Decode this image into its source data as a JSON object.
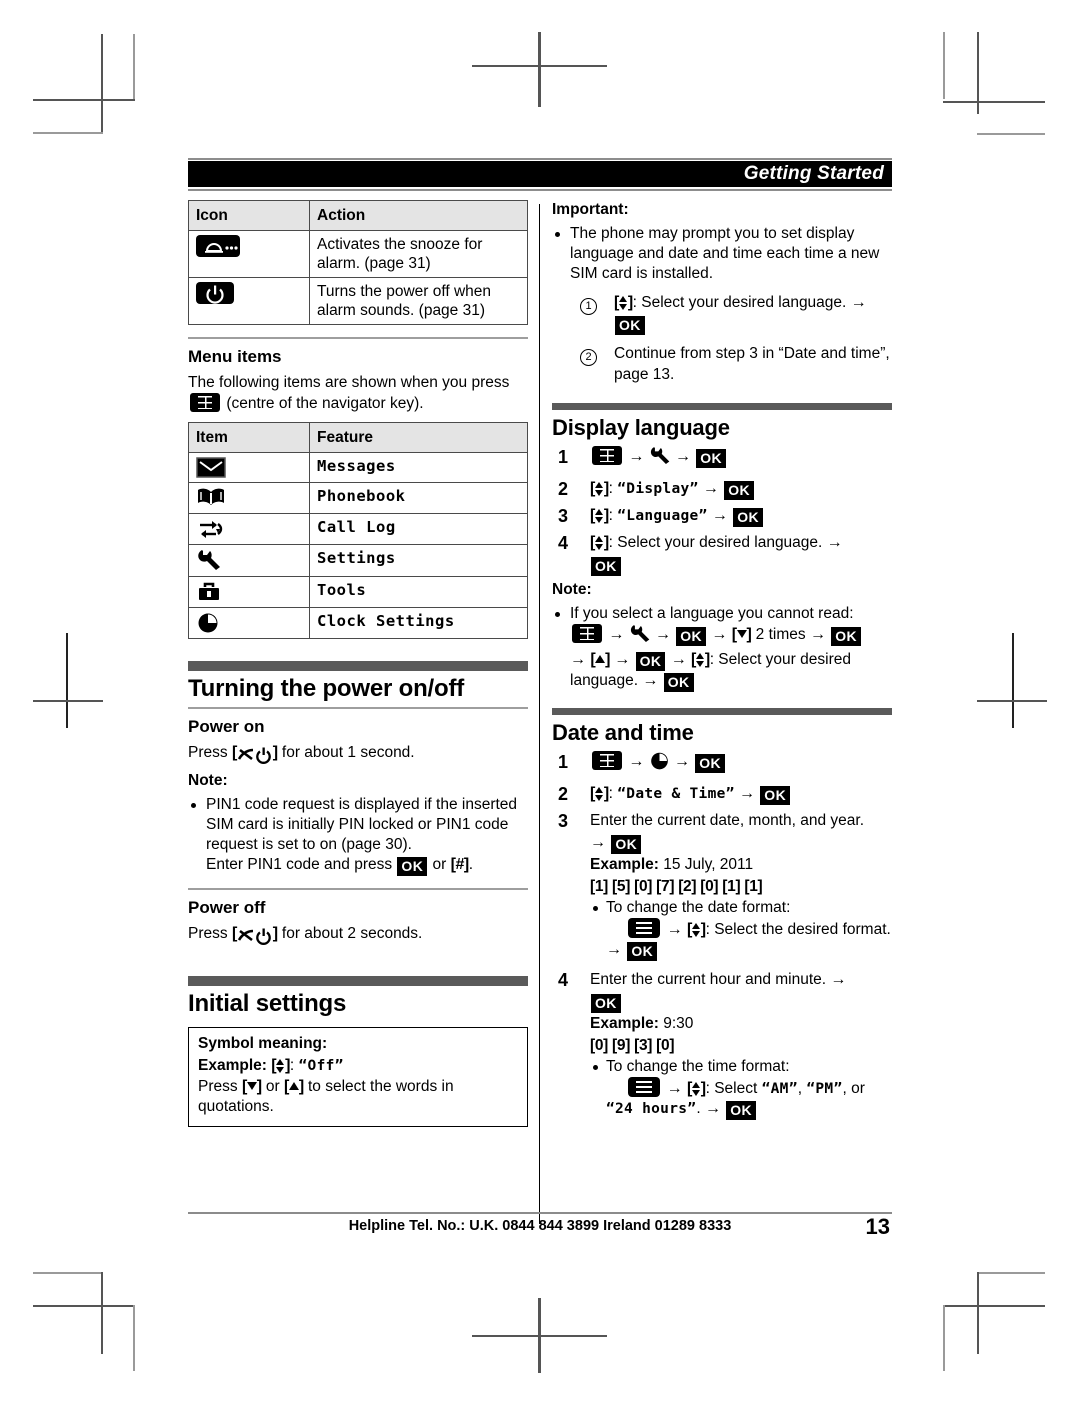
{
  "header": {
    "title": "Getting Started"
  },
  "icon_table": {
    "columns": [
      "Icon",
      "Action"
    ],
    "rows": [
      {
        "icon": "alarm-snooze-icon",
        "action": "Activates the snooze for alarm. (page 31)"
      },
      {
        "icon": "power-off-icon",
        "action": "Turns the power off when alarm sounds. (page 31)"
      }
    ]
  },
  "menu_items": {
    "heading": "Menu items",
    "intro_before": "The following items are shown when you press",
    "intro_after": "(centre of the navigator key).",
    "columns": [
      "Item",
      "Feature"
    ],
    "rows": [
      {
        "icon": "envelope-icon",
        "feature": "Messages"
      },
      {
        "icon": "phonebook-icon",
        "feature": "Phonebook"
      },
      {
        "icon": "call-log-icon",
        "feature": "Call Log"
      },
      {
        "icon": "wrench-icon",
        "feature": "Settings"
      },
      {
        "icon": "toolbox-icon",
        "feature": "Tools"
      },
      {
        "icon": "clock-icon",
        "feature": "Clock Settings"
      }
    ]
  },
  "turning_power": {
    "title": "Turning the power on/off",
    "power_on": {
      "heading": "Power on",
      "press_prefix": "Press",
      "press_suffix": "for about 1 second.",
      "note_label": "Note:",
      "note_line1": "PIN1 code request is displayed if the inserted SIM card is initially PIN locked or PIN1 code request is set to on (page 30).",
      "note_line2_a": "Enter PIN1 code and press",
      "note_ok": "OK",
      "note_line2_b": "or",
      "note_hash": "[#]",
      "note_end": "."
    },
    "power_off": {
      "heading": "Power off",
      "press_prefix": "Press",
      "press_suffix": "for about 2 seconds."
    }
  },
  "initial_settings": {
    "title": "Initial settings",
    "symbol_box": {
      "heading": "Symbol meaning:",
      "example_label": "Example:",
      "example_value": "“Off”",
      "press_a": "Press",
      "press_b": "or",
      "press_c": "to select the words in quotations."
    }
  },
  "important": {
    "label": "Important:",
    "bullet": "The phone may prompt you to set display language and date and time each time a new SIM card is installed.",
    "steps": [
      {
        "num": "1",
        "text_a": ": Select your desired language.",
        "arrow": "→",
        "ok": "OK"
      },
      {
        "num": "2",
        "text_a": "Continue from step 3 in “Date and time”, page 13."
      }
    ]
  },
  "display_language": {
    "title": "Display language",
    "steps": [
      {
        "num": "1",
        "kind": "grid-wrench-ok"
      },
      {
        "num": "2",
        "quoted": "“Display”",
        "ok": "OK"
      },
      {
        "num": "3",
        "quoted": "“Language”",
        "ok": "OK"
      },
      {
        "num": "4",
        "text": ": Select your desired language.",
        "ok": "OK"
      }
    ],
    "note_label": "Note:",
    "note": {
      "line1": "If you select a language you cannot read:",
      "times_text": "2 times",
      "select_text": ": Select your desired",
      "language_text": "language.",
      "ok": "OK"
    }
  },
  "date_and_time": {
    "title": "Date and time",
    "steps": [
      {
        "num": "1",
        "kind": "grid-clock-ok"
      },
      {
        "num": "2",
        "quoted": "“Date & Time”",
        "ok": "OK"
      },
      {
        "num": "3",
        "text": "Enter the current date, month, and year.",
        "ok": "OK",
        "example_label": "Example:",
        "example_value": "15 July, 2011",
        "keys": "[1] [5] [0] [7] [2] [0] [1] [1]",
        "bullet": "To change the date format:",
        "bullet_detail": ": Select the desired format."
      },
      {
        "num": "4",
        "text": "Enter the current hour and minute.",
        "ok": "OK",
        "example_label": "Example:",
        "example_value": "9:30",
        "keys": "[0] [9] [3] [0]",
        "bullet": "To change the time format:",
        "bullet_detail_a": ": Select",
        "opt1": "“AM”",
        "opt2": "“PM”",
        "opt_or": ", or",
        "opt3": "“24 hours”",
        "bullet_detail_b": "."
      }
    ]
  },
  "footer": {
    "helpline": "Helpline Tel. No.: U.K. 0844 844 3899 Ireland 01289 8333",
    "page_number": "13"
  },
  "colors": {
    "header_bar": "#000000",
    "rule_grey": "#5a5a5a",
    "table_header_bg": "#e4e4e4"
  }
}
